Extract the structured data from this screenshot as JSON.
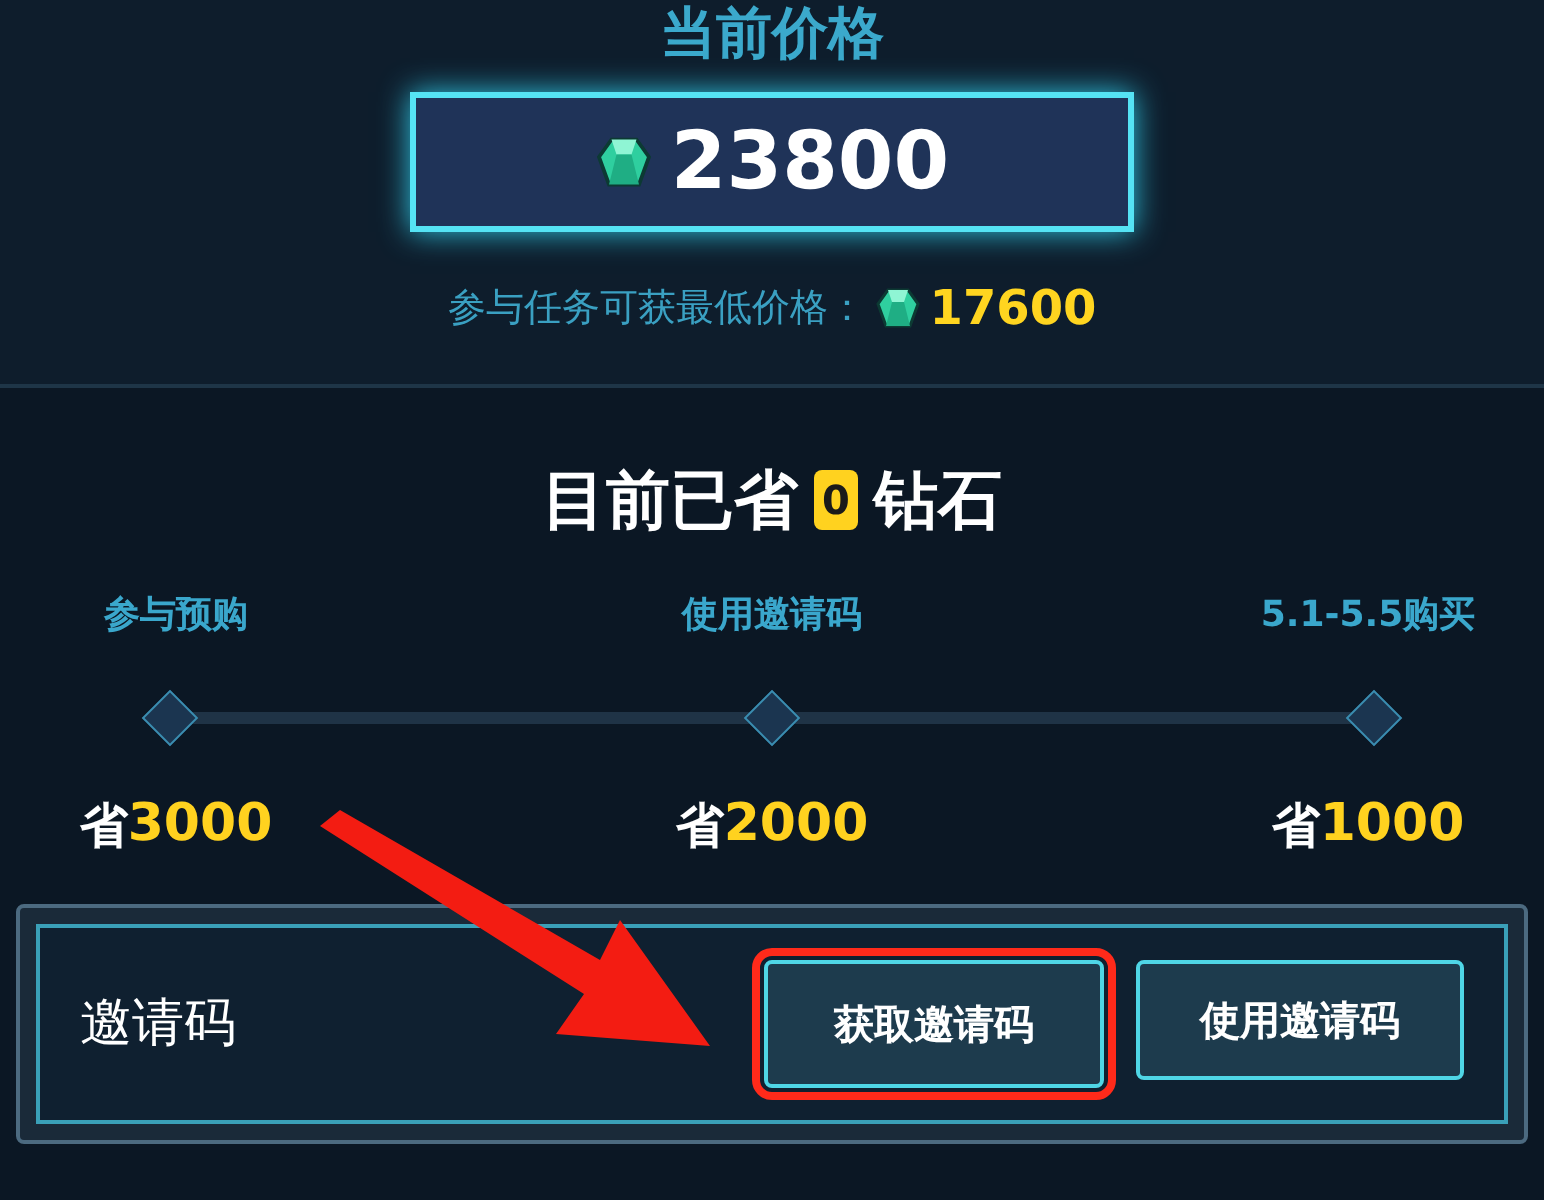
{
  "header": {
    "title": "当前价格"
  },
  "price": {
    "amount": "23800"
  },
  "min_price": {
    "label": "参与任务可获最低价格：",
    "amount": "17600"
  },
  "saved": {
    "prefix": "目前已省",
    "amount": "0",
    "suffix": "钻石"
  },
  "milestones": [
    {
      "label": "参与预购",
      "save_prefix": "省",
      "amount": "3000"
    },
    {
      "label": "使用邀请码",
      "save_prefix": "省",
      "amount": "2000"
    },
    {
      "label": "5.1-5.5购买",
      "save_prefix": "省",
      "amount": "1000"
    }
  ],
  "invite": {
    "label": "邀请码",
    "buttons": [
      {
        "label": "获取邀请码",
        "highlighted": true
      },
      {
        "label": "使用邀请码",
        "highlighted": false
      }
    ]
  }
}
